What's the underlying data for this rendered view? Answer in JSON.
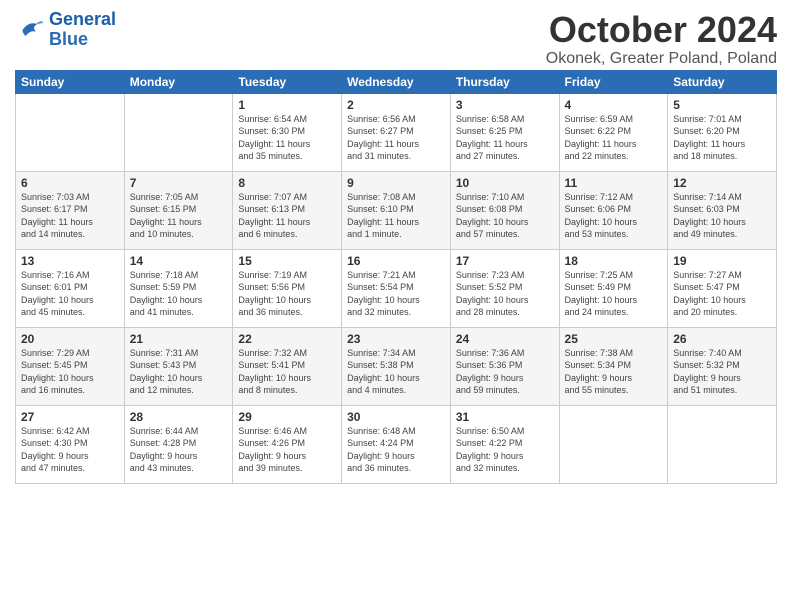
{
  "logo": {
    "line1": "General",
    "line2": "Blue"
  },
  "header": {
    "month": "October 2024",
    "location": "Okonek, Greater Poland, Poland"
  },
  "days_of_week": [
    "Sunday",
    "Monday",
    "Tuesday",
    "Wednesday",
    "Thursday",
    "Friday",
    "Saturday"
  ],
  "weeks": [
    [
      {
        "day": "",
        "info": ""
      },
      {
        "day": "",
        "info": ""
      },
      {
        "day": "1",
        "info": "Sunrise: 6:54 AM\nSunset: 6:30 PM\nDaylight: 11 hours\nand 35 minutes."
      },
      {
        "day": "2",
        "info": "Sunrise: 6:56 AM\nSunset: 6:27 PM\nDaylight: 11 hours\nand 31 minutes."
      },
      {
        "day": "3",
        "info": "Sunrise: 6:58 AM\nSunset: 6:25 PM\nDaylight: 11 hours\nand 27 minutes."
      },
      {
        "day": "4",
        "info": "Sunrise: 6:59 AM\nSunset: 6:22 PM\nDaylight: 11 hours\nand 22 minutes."
      },
      {
        "day": "5",
        "info": "Sunrise: 7:01 AM\nSunset: 6:20 PM\nDaylight: 11 hours\nand 18 minutes."
      }
    ],
    [
      {
        "day": "6",
        "info": "Sunrise: 7:03 AM\nSunset: 6:17 PM\nDaylight: 11 hours\nand 14 minutes."
      },
      {
        "day": "7",
        "info": "Sunrise: 7:05 AM\nSunset: 6:15 PM\nDaylight: 11 hours\nand 10 minutes."
      },
      {
        "day": "8",
        "info": "Sunrise: 7:07 AM\nSunset: 6:13 PM\nDaylight: 11 hours\nand 6 minutes."
      },
      {
        "day": "9",
        "info": "Sunrise: 7:08 AM\nSunset: 6:10 PM\nDaylight: 11 hours\nand 1 minute."
      },
      {
        "day": "10",
        "info": "Sunrise: 7:10 AM\nSunset: 6:08 PM\nDaylight: 10 hours\nand 57 minutes."
      },
      {
        "day": "11",
        "info": "Sunrise: 7:12 AM\nSunset: 6:06 PM\nDaylight: 10 hours\nand 53 minutes."
      },
      {
        "day": "12",
        "info": "Sunrise: 7:14 AM\nSunset: 6:03 PM\nDaylight: 10 hours\nand 49 minutes."
      }
    ],
    [
      {
        "day": "13",
        "info": "Sunrise: 7:16 AM\nSunset: 6:01 PM\nDaylight: 10 hours\nand 45 minutes."
      },
      {
        "day": "14",
        "info": "Sunrise: 7:18 AM\nSunset: 5:59 PM\nDaylight: 10 hours\nand 41 minutes."
      },
      {
        "day": "15",
        "info": "Sunrise: 7:19 AM\nSunset: 5:56 PM\nDaylight: 10 hours\nand 36 minutes."
      },
      {
        "day": "16",
        "info": "Sunrise: 7:21 AM\nSunset: 5:54 PM\nDaylight: 10 hours\nand 32 minutes."
      },
      {
        "day": "17",
        "info": "Sunrise: 7:23 AM\nSunset: 5:52 PM\nDaylight: 10 hours\nand 28 minutes."
      },
      {
        "day": "18",
        "info": "Sunrise: 7:25 AM\nSunset: 5:49 PM\nDaylight: 10 hours\nand 24 minutes."
      },
      {
        "day": "19",
        "info": "Sunrise: 7:27 AM\nSunset: 5:47 PM\nDaylight: 10 hours\nand 20 minutes."
      }
    ],
    [
      {
        "day": "20",
        "info": "Sunrise: 7:29 AM\nSunset: 5:45 PM\nDaylight: 10 hours\nand 16 minutes."
      },
      {
        "day": "21",
        "info": "Sunrise: 7:31 AM\nSunset: 5:43 PM\nDaylight: 10 hours\nand 12 minutes."
      },
      {
        "day": "22",
        "info": "Sunrise: 7:32 AM\nSunset: 5:41 PM\nDaylight: 10 hours\nand 8 minutes."
      },
      {
        "day": "23",
        "info": "Sunrise: 7:34 AM\nSunset: 5:38 PM\nDaylight: 10 hours\nand 4 minutes."
      },
      {
        "day": "24",
        "info": "Sunrise: 7:36 AM\nSunset: 5:36 PM\nDaylight: 9 hours\nand 59 minutes."
      },
      {
        "day": "25",
        "info": "Sunrise: 7:38 AM\nSunset: 5:34 PM\nDaylight: 9 hours\nand 55 minutes."
      },
      {
        "day": "26",
        "info": "Sunrise: 7:40 AM\nSunset: 5:32 PM\nDaylight: 9 hours\nand 51 minutes."
      }
    ],
    [
      {
        "day": "27",
        "info": "Sunrise: 6:42 AM\nSunset: 4:30 PM\nDaylight: 9 hours\nand 47 minutes."
      },
      {
        "day": "28",
        "info": "Sunrise: 6:44 AM\nSunset: 4:28 PM\nDaylight: 9 hours\nand 43 minutes."
      },
      {
        "day": "29",
        "info": "Sunrise: 6:46 AM\nSunset: 4:26 PM\nDaylight: 9 hours\nand 39 minutes."
      },
      {
        "day": "30",
        "info": "Sunrise: 6:48 AM\nSunset: 4:24 PM\nDaylight: 9 hours\nand 36 minutes."
      },
      {
        "day": "31",
        "info": "Sunrise: 6:50 AM\nSunset: 4:22 PM\nDaylight: 9 hours\nand 32 minutes."
      },
      {
        "day": "",
        "info": ""
      },
      {
        "day": "",
        "info": ""
      }
    ]
  ]
}
